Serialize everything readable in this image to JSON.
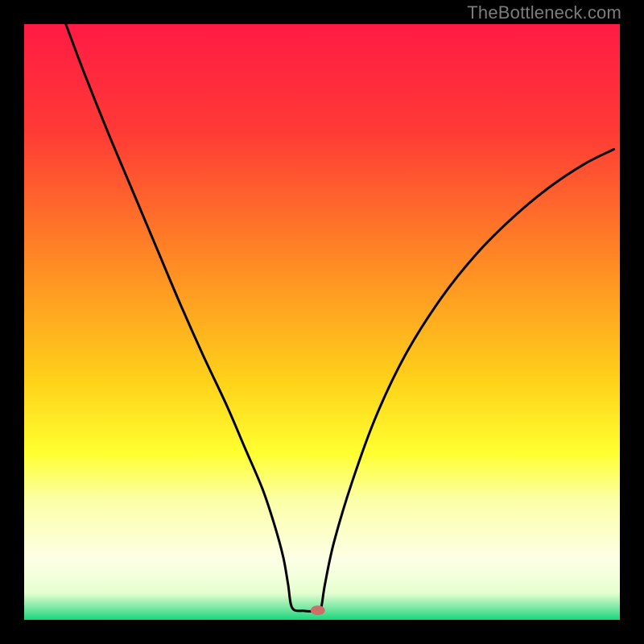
{
  "watermark": "TheBottleneck.com",
  "chart_data": {
    "type": "line",
    "title": "",
    "xlabel": "",
    "ylabel": "",
    "xlim": [
      0,
      100
    ],
    "ylim": [
      0,
      100
    ],
    "grid": false,
    "legend": false,
    "gradient_stops": [
      {
        "offset": 0.0,
        "color": "#ff1b44"
      },
      {
        "offset": 0.18,
        "color": "#ff3a36"
      },
      {
        "offset": 0.4,
        "color": "#ff8a24"
      },
      {
        "offset": 0.6,
        "color": "#ffd21a"
      },
      {
        "offset": 0.72,
        "color": "#ffff30"
      },
      {
        "offset": 0.8,
        "color": "#fbffa8"
      },
      {
        "offset": 0.9,
        "color": "#fdffe6"
      },
      {
        "offset": 0.955,
        "color": "#e6ffd0"
      },
      {
        "offset": 0.985,
        "color": "#63e39a"
      },
      {
        "offset": 1.0,
        "color": "#16d67a"
      }
    ],
    "curve": {
      "x": [
        7.0,
        10.0,
        14.0,
        18.0,
        22.0,
        26.0,
        30.0,
        34.0,
        37.0,
        40.0,
        42.0,
        43.5,
        44.3,
        45.0,
        47.0,
        49.0,
        49.8,
        50.5,
        52.0,
        55.0,
        59.0,
        64.0,
        70.0,
        76.0,
        82.0,
        88.0,
        94.0,
        99.0
      ],
      "y": [
        100.0,
        92.0,
        82.0,
        72.5,
        63.0,
        53.5,
        44.5,
        36.0,
        29.0,
        22.0,
        16.0,
        10.5,
        6.0,
        2.0,
        1.5,
        1.5,
        1.8,
        6.0,
        13.0,
        23.0,
        34.0,
        44.5,
        54.0,
        61.5,
        67.5,
        72.5,
        76.5,
        79.0
      ]
    },
    "marker": {
      "x": 49.3,
      "y": 1.6,
      "rx": 1.2,
      "ry": 0.8,
      "color": "#cb6f67"
    }
  }
}
